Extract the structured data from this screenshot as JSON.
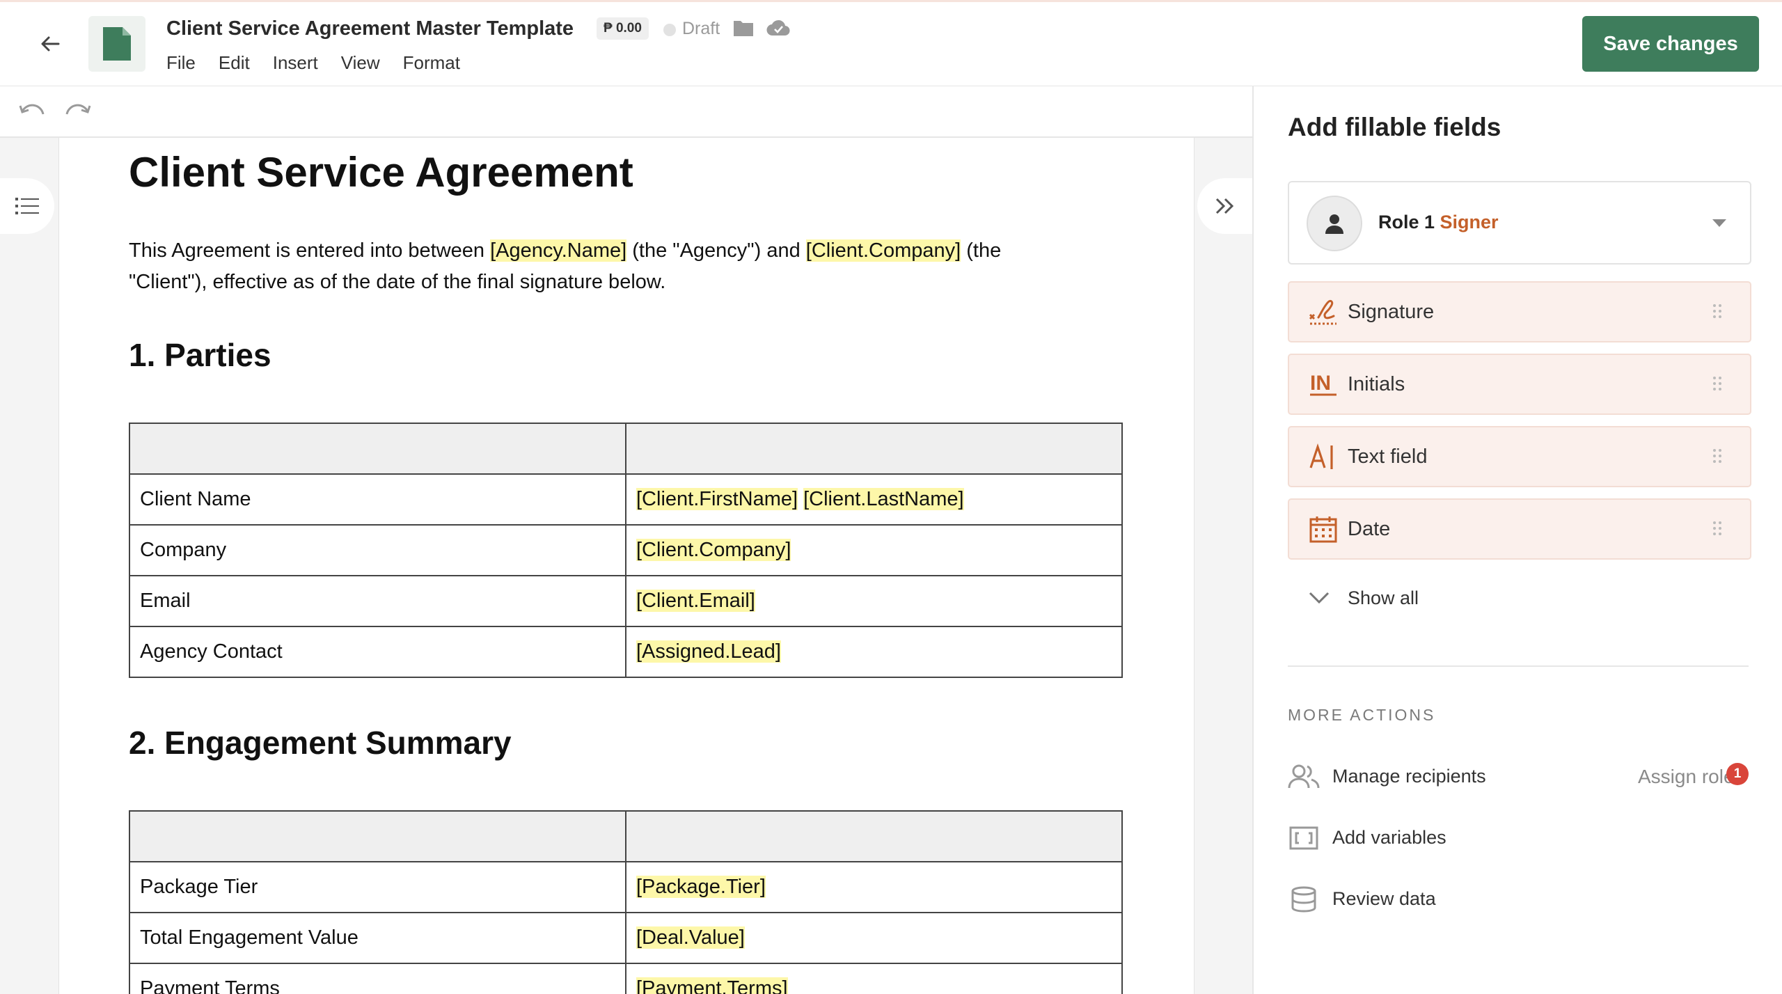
{
  "header": {
    "title": "Client Service Agreement Master Template",
    "price": "₱ 0.00",
    "status": "Draft",
    "menu": [
      "File",
      "Edit",
      "Insert",
      "View",
      "Format"
    ],
    "save_label": "Save changes"
  },
  "document": {
    "heading": "Client Service Agreement",
    "intro": {
      "t1": "This Agreement is entered into between ",
      "v1": "[Agency.Name]",
      "t2": " (the \"Agency\") and ",
      "v2": "[Client.Company]",
      "t3": " (the \"Client\"), effective as of the date of the final signature below."
    },
    "section1": {
      "title": "1. Parties",
      "rows": [
        {
          "label": "Client Name",
          "v1": "[Client.FirstName]",
          "v2": "[Client.LastName]"
        },
        {
          "label": "Company",
          "v1": "[Client.Company]"
        },
        {
          "label": "Email",
          "v1": "[Client.Email]"
        },
        {
          "label": "Agency Contact",
          "v1": "[Assigned.Lead]"
        }
      ]
    },
    "section2": {
      "title": "2. Engagement Summary",
      "rows": [
        {
          "label": "Package Tier",
          "v1": "[Package.Tier]"
        },
        {
          "label": "Total Engagement Value",
          "v1": "[Deal.Value]"
        },
        {
          "label": "Payment Terms",
          "v1": "[Payment.Terms]"
        }
      ]
    }
  },
  "panel": {
    "title": "Add fillable fields",
    "role": {
      "name": "Role 1",
      "type": "Signer"
    },
    "fields": [
      "Signature",
      "Initials",
      "Text field",
      "Date"
    ],
    "show_all": "Show all",
    "more_actions_label": "MORE ACTIONS",
    "actions": [
      "Manage recipients",
      "Add variables",
      "Review data"
    ],
    "assign_roles": "Assign roles",
    "assign_badge": "1"
  },
  "icons": {
    "back": "arrow-left-icon",
    "doc": "document-icon",
    "undo": "undo-icon",
    "redo": "redo-icon",
    "toc": "list-icon",
    "collapse": "double-chevron-right-icon",
    "folder": "folder-icon",
    "cloud": "cloud-check-icon"
  },
  "colors": {
    "brand": "#3e7d5c",
    "accent": "#c4602a",
    "highlight": "#fdf7a9",
    "field_bg": "#fbf0ec",
    "badge": "#d9453a"
  }
}
